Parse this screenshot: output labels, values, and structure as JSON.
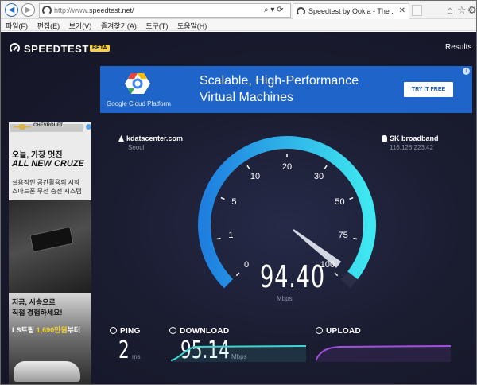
{
  "browser": {
    "address_url_dim": "http://www.",
    "address_url_main": "speedtest.net/",
    "address_controls": "⌕ ▾ ⟳",
    "tab_title": "Speedtest by Ookla - The ...",
    "menu": [
      "파일(F)",
      "편집(E)",
      "보기(V)",
      "즐겨찾기(A)",
      "도구(T)",
      "도움말(H)"
    ]
  },
  "header": {
    "brand": "SPEEDTEST",
    "beta": "BETA",
    "results": "Results"
  },
  "ad_top": {
    "sponsor": "Google Cloud Platform",
    "headline": "Scalable, High-Performance\nVirtual Machines",
    "cta": "TRY IT FREE"
  },
  "ad_left": {
    "brand": "CHEVROLET",
    "line1": "오늘, 가장 멋진",
    "line2": "ALL NEW CRUZE",
    "line3": "실용적인 공간활용의 시작\n스마트폰 무선 충전 시스템",
    "bottom1": "지금, 시승으로\n직접 경험하세요!",
    "bottom2_prefix": "LS트림 ",
    "bottom2_price": "1,690만원",
    "bottom2_suffix": "부터"
  },
  "server": {
    "host": "kdatacenter.com",
    "city": "Seoul",
    "isp": "SK broadband",
    "ip": "116.126.223.42"
  },
  "gauge": {
    "tick_labels": [
      "0",
      "1",
      "5",
      "10",
      "20",
      "30",
      "50",
      "75",
      "100"
    ],
    "max_value": 100,
    "current_value": 94.4,
    "speed_text": "94.40",
    "unit": "Mbps",
    "colors": {
      "arc_start": "#1f7fe0",
      "arc_end": "#3fe8f0",
      "track": "#2a2d45"
    }
  },
  "metrics": {
    "ping": {
      "label": "PING",
      "value": "2",
      "unit": "ms"
    },
    "download": {
      "label": "DOWNLOAD",
      "value": "95.14",
      "unit": "Mbps",
      "color": "#3fd6d0"
    },
    "upload": {
      "label": "UPLOAD",
      "color": "#a250e0"
    }
  }
}
